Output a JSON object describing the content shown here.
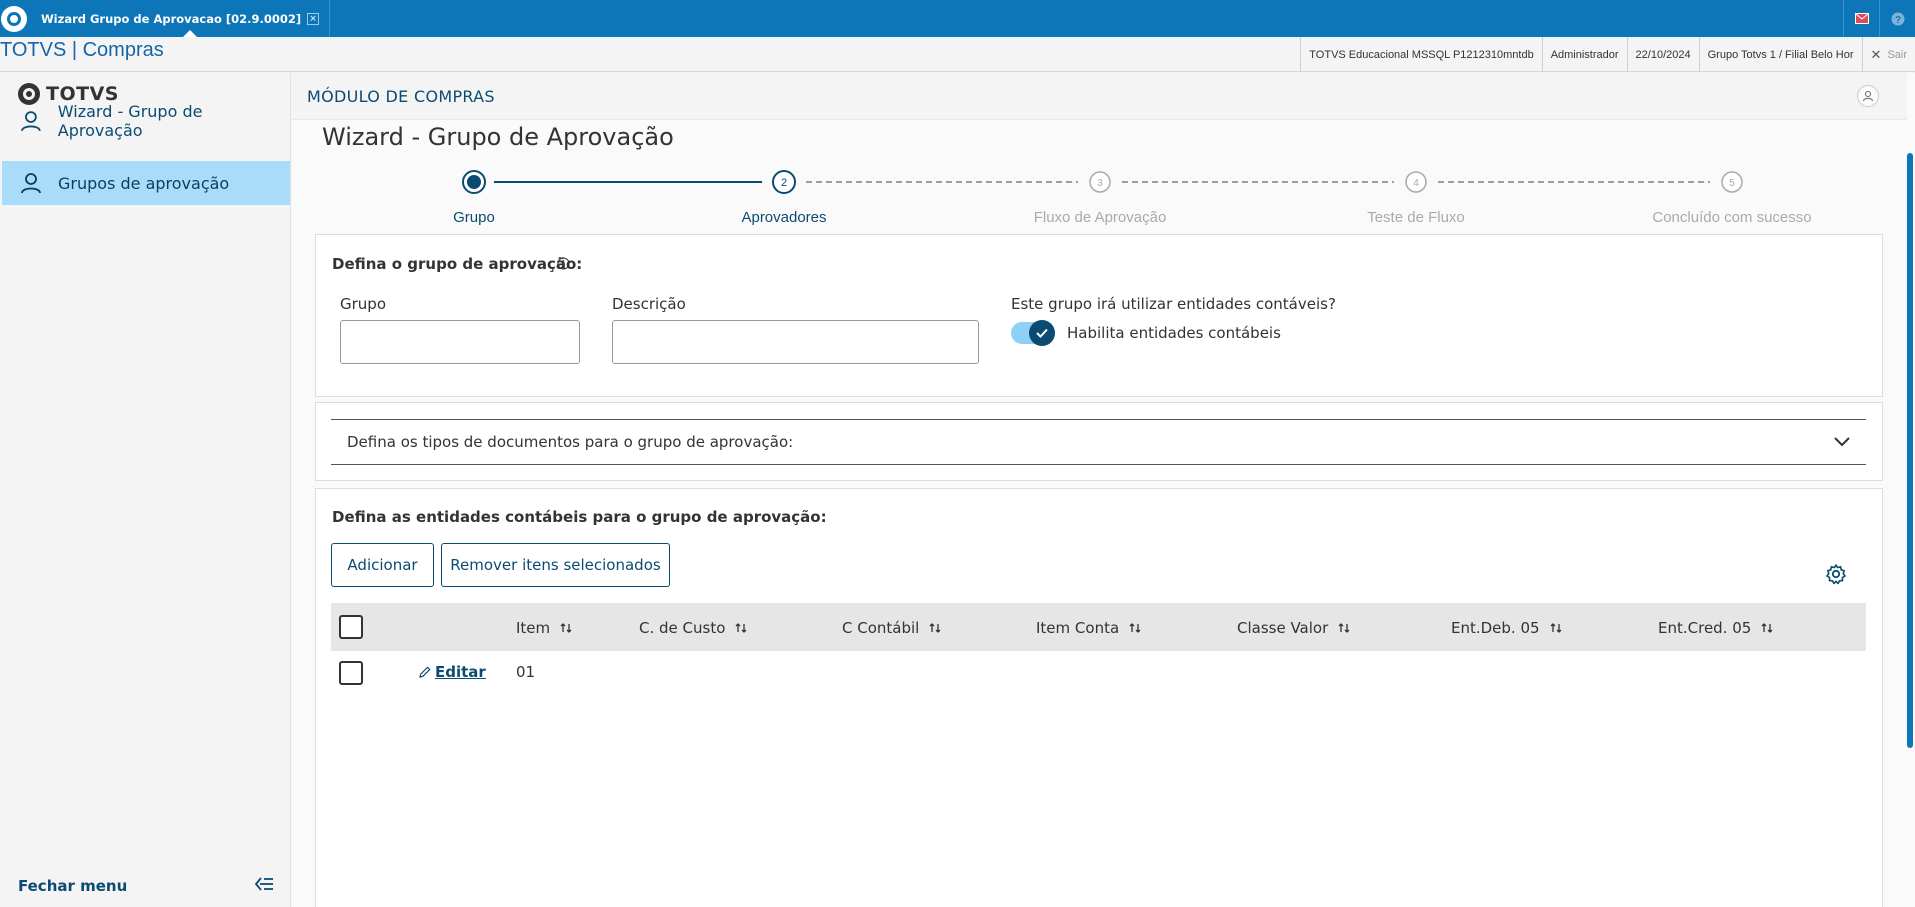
{
  "topbar": {
    "tab_label": "Wizard Grupo de Aprovacao [02.9.0002]",
    "tab_close": "×",
    "mail_icon": "mail-icon",
    "help_icon": "help-icon"
  },
  "infobar": {
    "brand": "TOTVS | Compras",
    "items": [
      "TOTVS Educacional MSSQL P1212310mntdb",
      "Administrador",
      "22/10/2024",
      "Grupo Totvs 1 / Filial Belo Hor"
    ],
    "exit_label": "Sair"
  },
  "sidebar": {
    "logo": "TOTVS",
    "items": [
      {
        "label": "Wizard - Grupo de Aprovação",
        "icon": "user-icon"
      },
      {
        "label": "Grupos de aprovação",
        "icon": "user-icon"
      }
    ],
    "footer_label": "Fechar menu"
  },
  "header": {
    "module_title": "MÓDULO DE COMPRAS",
    "page_title": "Wizard - Grupo de Aprovação"
  },
  "stepper": {
    "steps": [
      {
        "num": "1",
        "label": "Grupo",
        "state": "active"
      },
      {
        "num": "2",
        "label": "Aprovadores",
        "state": "next"
      },
      {
        "num": "3",
        "label": "Fluxo de Aprovação",
        "state": "disabled"
      },
      {
        "num": "4",
        "label": "Teste de Fluxo",
        "state": "disabled"
      },
      {
        "num": "5",
        "label": "Concluído com sucesso",
        "state": "disabled"
      }
    ]
  },
  "group_form": {
    "title": "Defina o grupo de aprovação:",
    "grupo_label": "Grupo",
    "grupo_value": "",
    "descricao_label": "Descrição",
    "descricao_value": "",
    "question": "Este grupo irá utilizar entidades contáveis?",
    "toggle_label": "Habilita entidades contábeis",
    "toggle_on": true
  },
  "doc_types": {
    "title": "Defina os tipos de documentos para o grupo de aprovação:"
  },
  "entities": {
    "title": "Defina as entidades contábeis para o grupo de aprovação:",
    "add_button": "Adicionar",
    "remove_button": "Remover itens selecionados",
    "columns": [
      "Item",
      "C. de Custo",
      "C Contábil",
      "Item Conta",
      "Classe Valor",
      "Ent.Deb. 05",
      "Ent.Cred. 05"
    ],
    "rows": [
      {
        "edit_label": "Editar",
        "item": "01"
      }
    ]
  },
  "colors": {
    "topbar": "#0c76b8",
    "accent": "#0b4b72",
    "sidebar_active": "#a8dcf9"
  }
}
